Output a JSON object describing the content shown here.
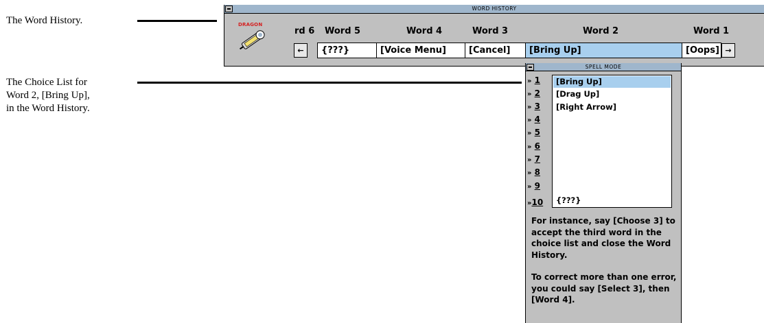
{
  "captions": {
    "word_history": "The Word History.",
    "choice_list": [
      "The Choice List for",
      "Word 2, [Bring Up],",
      "in the Word History."
    ]
  },
  "word_history": {
    "title": "WORD HISTORY",
    "logo_text": "DRAGON",
    "headers": [
      "rd 6",
      "Word 5",
      "Word 4",
      "Word 3",
      "Word 2",
      "Word 1"
    ],
    "slots": [
      "{???}",
      "[Voice Menu]",
      "[Cancel]",
      "[Bring Up]",
      "[Oops]"
    ],
    "selected_slot": "[Bring Up]",
    "left_arrow": "←",
    "right_arrow": "→"
  },
  "spell_mode": {
    "title": "SPELL MODE",
    "numbers": [
      "1",
      "2",
      "3",
      "4",
      "5",
      "6",
      "7",
      "8",
      "9",
      "10"
    ],
    "choices": [
      "[Bring Up]",
      "[Drag Up]",
      "[Right Arrow]",
      "",
      "",
      "",
      "",
      "",
      "",
      "{???}"
    ],
    "instructions": [
      "For instance, say [Choose 3] to accept the third word in the choice list and close the Word History.",
      "To correct more than one error, you could say [Select 3], then [Word 4]."
    ]
  },
  "colors": {
    "window_gray": "#c0c0c0",
    "title_blue": "#9fb6cc",
    "selection_blue": "#a8cfee",
    "logo_red": "#d42020"
  }
}
